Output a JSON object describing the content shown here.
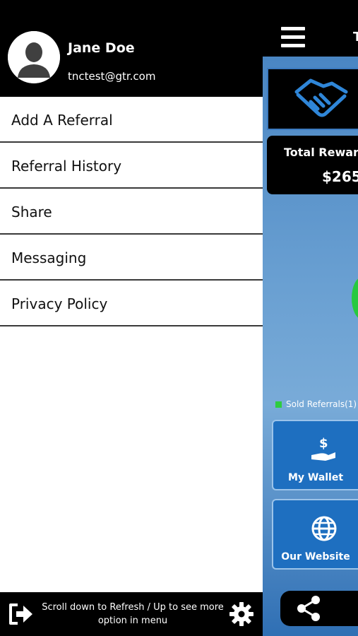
{
  "drawer": {
    "user_name": "Jane Doe",
    "user_email": "tnctest@gtr.com",
    "menu_items": [
      {
        "label": "Add A Referral"
      },
      {
        "label": "Referral History"
      },
      {
        "label": "Share"
      },
      {
        "label": "Messaging"
      },
      {
        "label": "Privacy Policy"
      }
    ],
    "footer_text": "Scroll down to Refresh / Up to see more option in menu"
  },
  "app": {
    "title_fragment": "T",
    "rewards_title": "Total Rewar",
    "rewards_value": "$265",
    "legend_label": "Sold Referrals(1)",
    "legend_color": "#2ecc40",
    "tiles": [
      {
        "label": "My Wallet",
        "icon": "wallet-icon"
      },
      {
        "label": "Our Website",
        "icon": "globe-icon"
      }
    ]
  },
  "colors": {
    "drawer_header": "#000000",
    "accent_blue": "#1e6fc0"
  }
}
